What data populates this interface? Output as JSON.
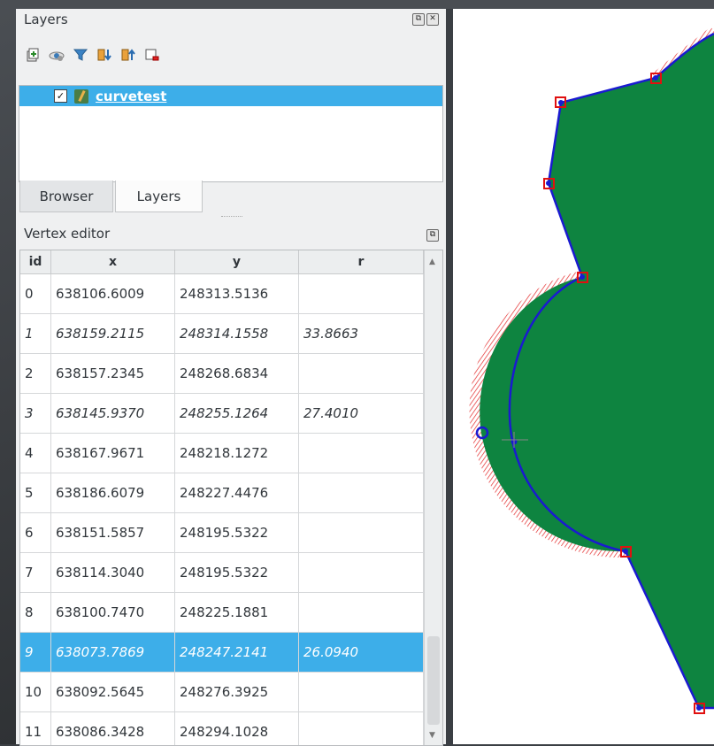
{
  "layers_panel": {
    "title": "Layers",
    "float_icon": "float-icon",
    "close_icon": "close-icon",
    "toolbar": [
      "add-group-icon",
      "visibility-icon",
      "filter-icon",
      "expand-all-icon",
      "collapse-all-icon",
      "remove-layer-icon"
    ],
    "layer": {
      "checked": true,
      "name": "curvetest",
      "icon": "pencil-edit-icon"
    }
  },
  "tabs": [
    "Browser",
    "Layers"
  ],
  "vertex_editor": {
    "title": "Vertex editor",
    "columns": [
      "id",
      "x",
      "y",
      "r"
    ],
    "rows": [
      {
        "id": "0",
        "x": "638106.6009",
        "y": "248313.5136",
        "r": "",
        "italic": false,
        "selected": false
      },
      {
        "id": "1",
        "x": "638159.2115",
        "y": "248314.1558",
        "r": "33.8663",
        "italic": true,
        "selected": false
      },
      {
        "id": "2",
        "x": "638157.2345",
        "y": "248268.6834",
        "r": "",
        "italic": false,
        "selected": false
      },
      {
        "id": "3",
        "x": "638145.9370",
        "y": "248255.1264",
        "r": "27.4010",
        "italic": true,
        "selected": false
      },
      {
        "id": "4",
        "x": "638167.9671",
        "y": "248218.1272",
        "r": "",
        "italic": false,
        "selected": false
      },
      {
        "id": "5",
        "x": "638186.6079",
        "y": "248227.4476",
        "r": "",
        "italic": false,
        "selected": false
      },
      {
        "id": "6",
        "x": "638151.5857",
        "y": "248195.5322",
        "r": "",
        "italic": false,
        "selected": false
      },
      {
        "id": "7",
        "x": "638114.3040",
        "y": "248195.5322",
        "r": "",
        "italic": false,
        "selected": false
      },
      {
        "id": "8",
        "x": "638100.7470",
        "y": "248225.1881",
        "r": "",
        "italic": false,
        "selected": false
      },
      {
        "id": "9",
        "x": "638073.7869",
        "y": "248247.2141",
        "r": "26.0940",
        "italic": true,
        "selected": true
      },
      {
        "id": "10",
        "x": "638092.5645",
        "y": "248276.3925",
        "r": "",
        "italic": false,
        "selected": false
      },
      {
        "id": "11",
        "x": "638086.3428",
        "y": "248294.1028",
        "r": "",
        "italic": false,
        "selected": false
      }
    ]
  },
  "map": {
    "fill_color": "#0e8440",
    "stroke_color": "#1a1ad0",
    "highlight_color": "#e01010"
  }
}
